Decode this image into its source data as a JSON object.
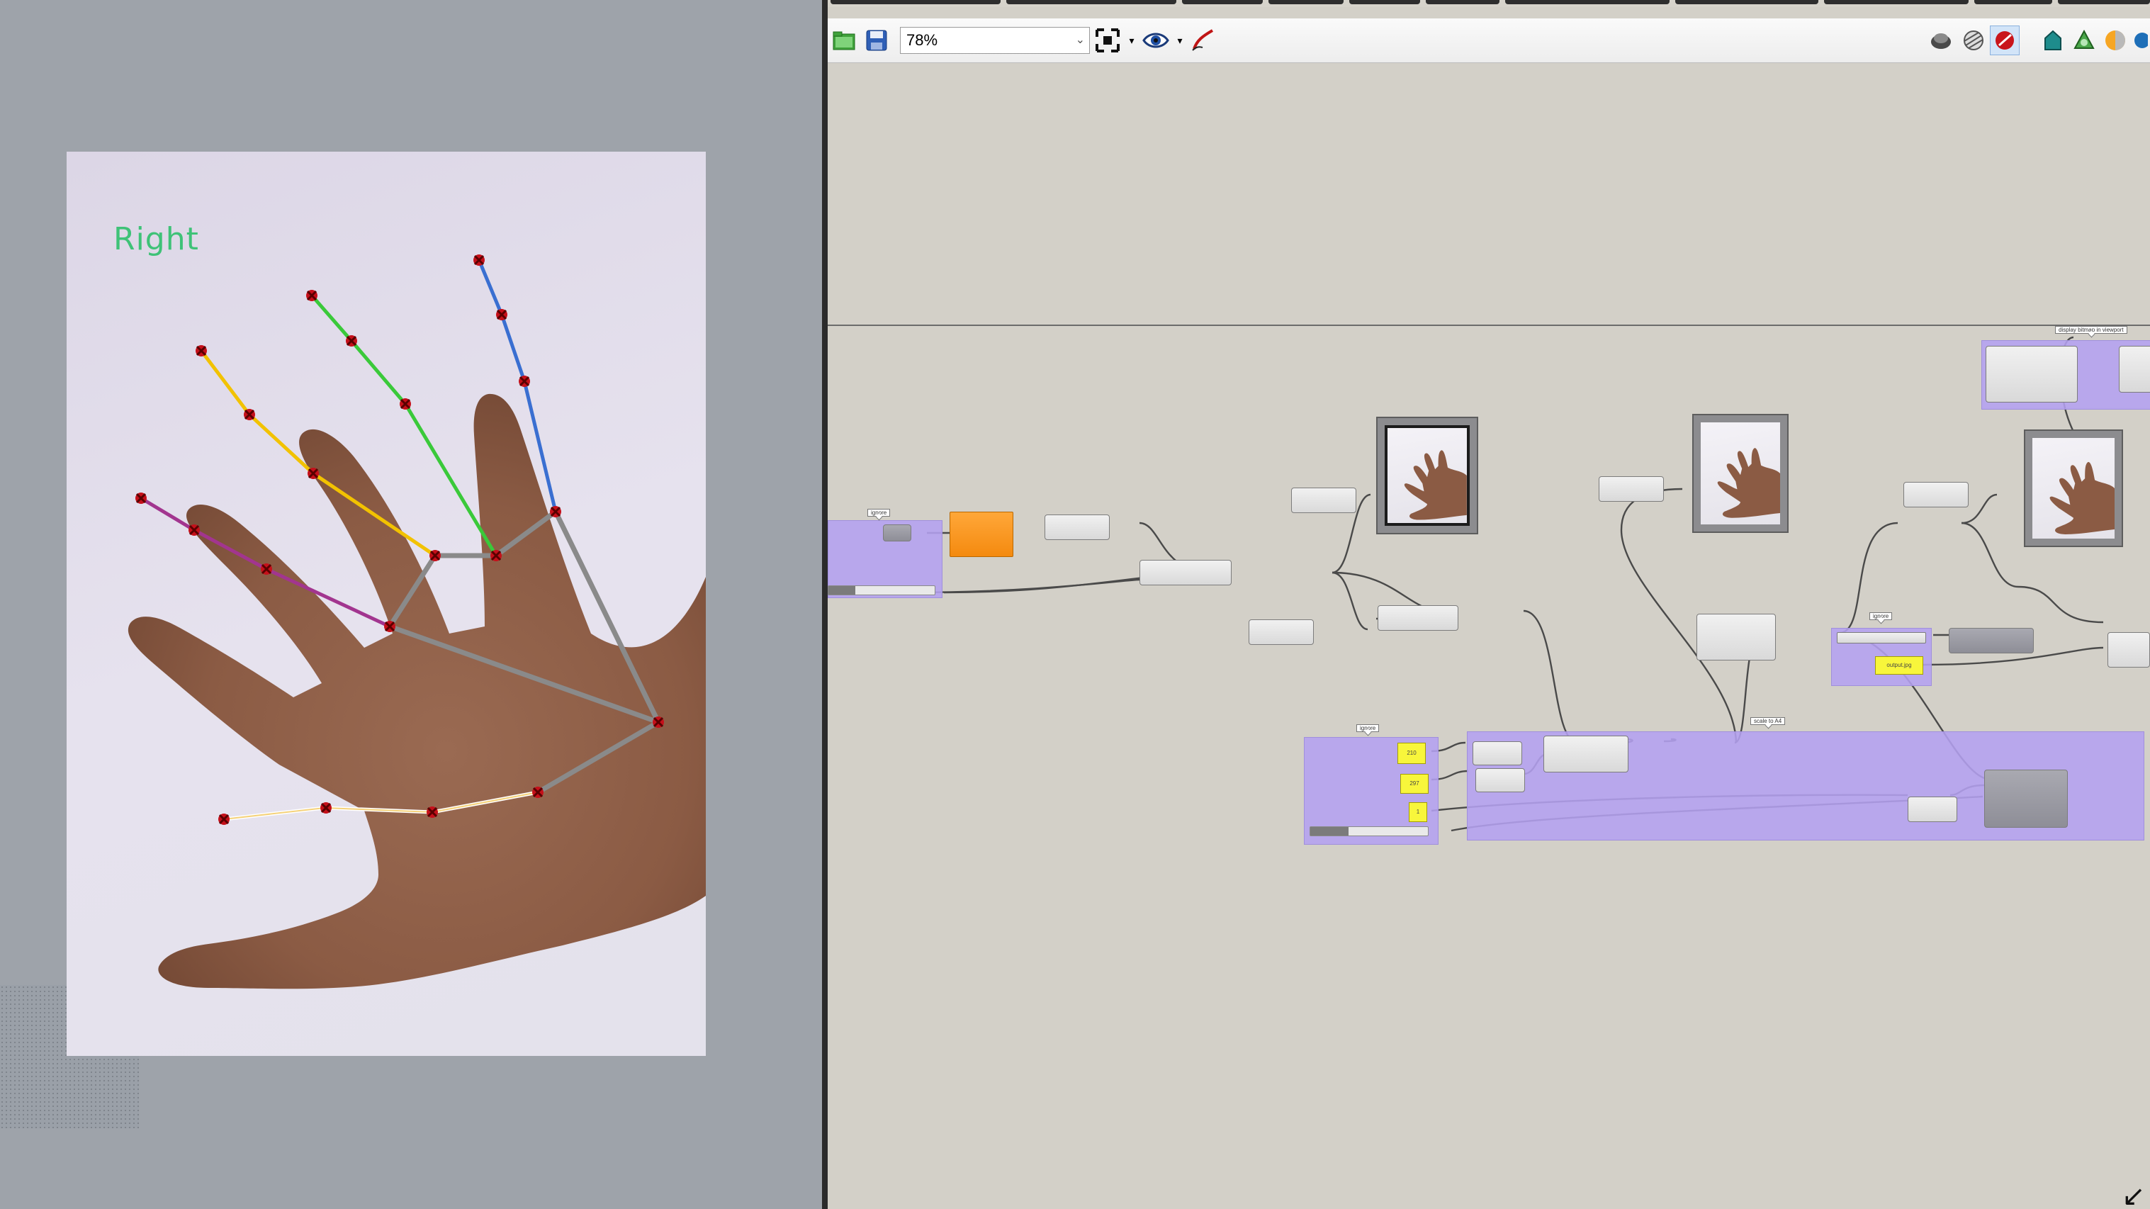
{
  "viewport": {
    "hand_label": "Right"
  },
  "toolbar": {
    "zoom_value": "78%",
    "icons": [
      "open-file-icon",
      "save-icon",
      "zoom-extents-icon",
      "preview-eye-icon",
      "sketch-pen-icon",
      "shaded-preview-icon",
      "wire-preview-icon",
      "selected-preview-icon",
      "bake-icon",
      "material-icon",
      "color-icon"
    ]
  },
  "canvas": {
    "bubble_labels": {
      "left_group": "ignore",
      "bottom_group": "ignore",
      "scale_group": "scale to A4",
      "output_group": "ignore",
      "display_group": "display bitmap in viewport"
    },
    "panels": {
      "p1": "210",
      "p2": "297",
      "p3": "1",
      "output_name": "output.jpg"
    }
  },
  "colors": {
    "canvas_bg": "#d3d0c8",
    "group_fill": "#b4a0f0",
    "component": "#e2e2e2",
    "orange_component": "#f48a0f",
    "panel_yellow": "#f8f63b",
    "label_green": "#3ec277",
    "thumb_line": "#ffffff",
    "index_line": "#f2c200",
    "middle_line": "#3ac93a",
    "ring_line": "#3a6fd1",
    "pinky_line": "#a2358f",
    "palm_line": "#888888",
    "landmark": "#b8000d"
  }
}
